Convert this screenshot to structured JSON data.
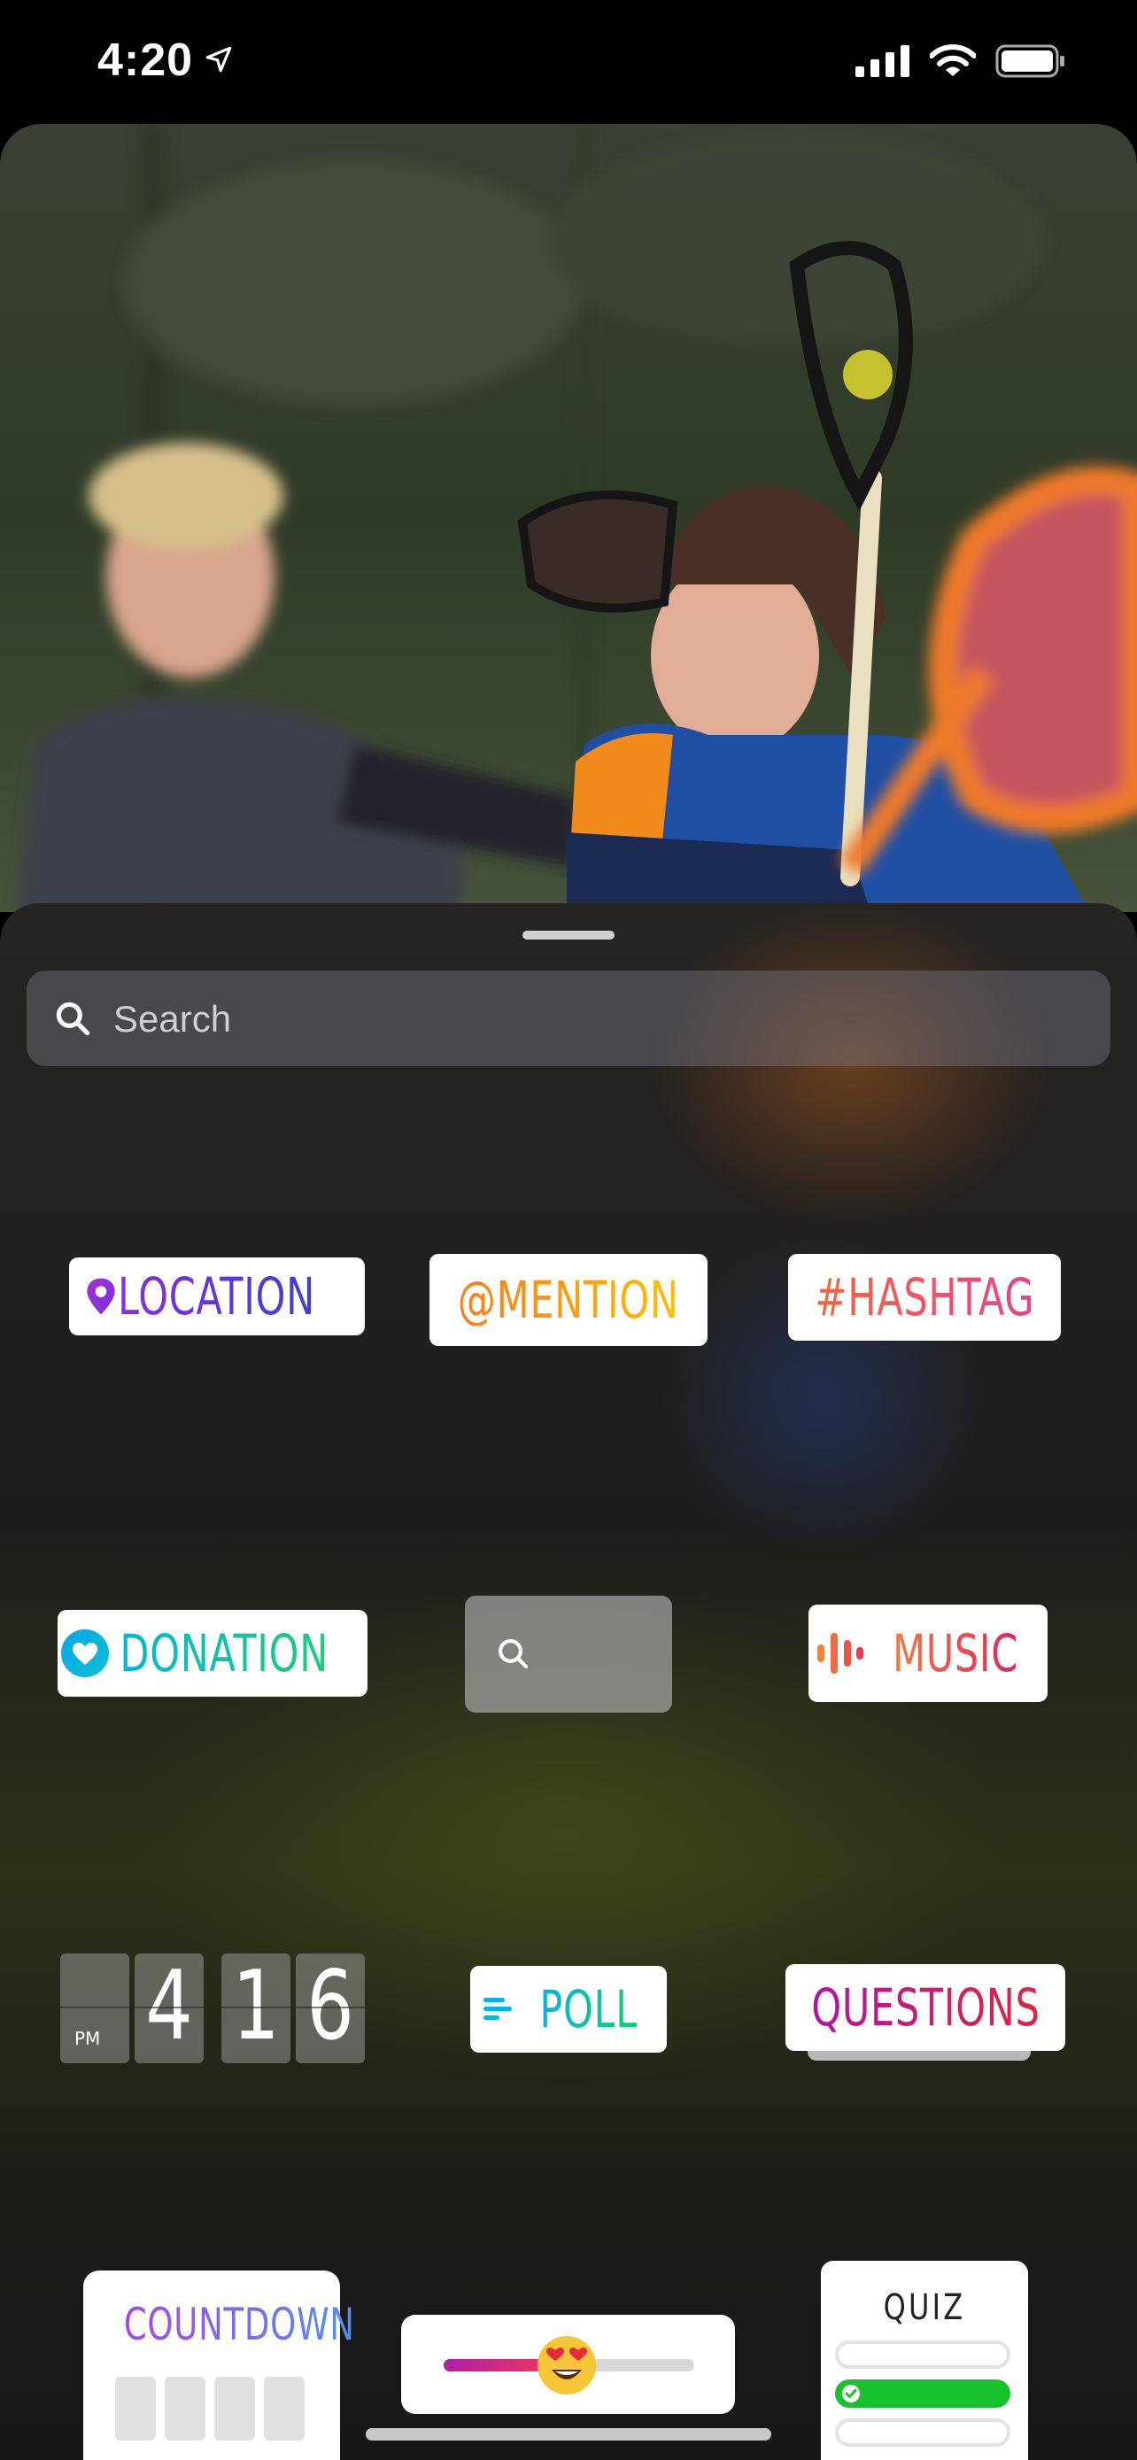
{
  "status_bar": {
    "time": "4:20"
  },
  "search": {
    "placeholder": "Search"
  },
  "stickers": {
    "location": "LOCATION",
    "mention": "@MENTION",
    "hashtag": "#HASHTAG",
    "donation": "DONATION",
    "music": "MUSIC",
    "poll": "POLL",
    "questions": "QUESTIONS",
    "countdown": "COUNTDOWN",
    "quiz": "QUIZ",
    "clock": {
      "meridiem": "PM",
      "hour": "4",
      "minute_tens": "1",
      "minute_ones": "6"
    },
    "slider": {
      "emoji": "😍",
      "level": 0.45
    }
  },
  "colors": {
    "quiz_correct": "#18c22c"
  },
  "icons": [
    "location-arrow-icon",
    "signal-icon",
    "wifi-icon",
    "battery-icon",
    "search-icon",
    "location-pin-icon",
    "heart-icon",
    "music-bars-icon",
    "poll-lines-icon",
    "checkmark-icon"
  ]
}
